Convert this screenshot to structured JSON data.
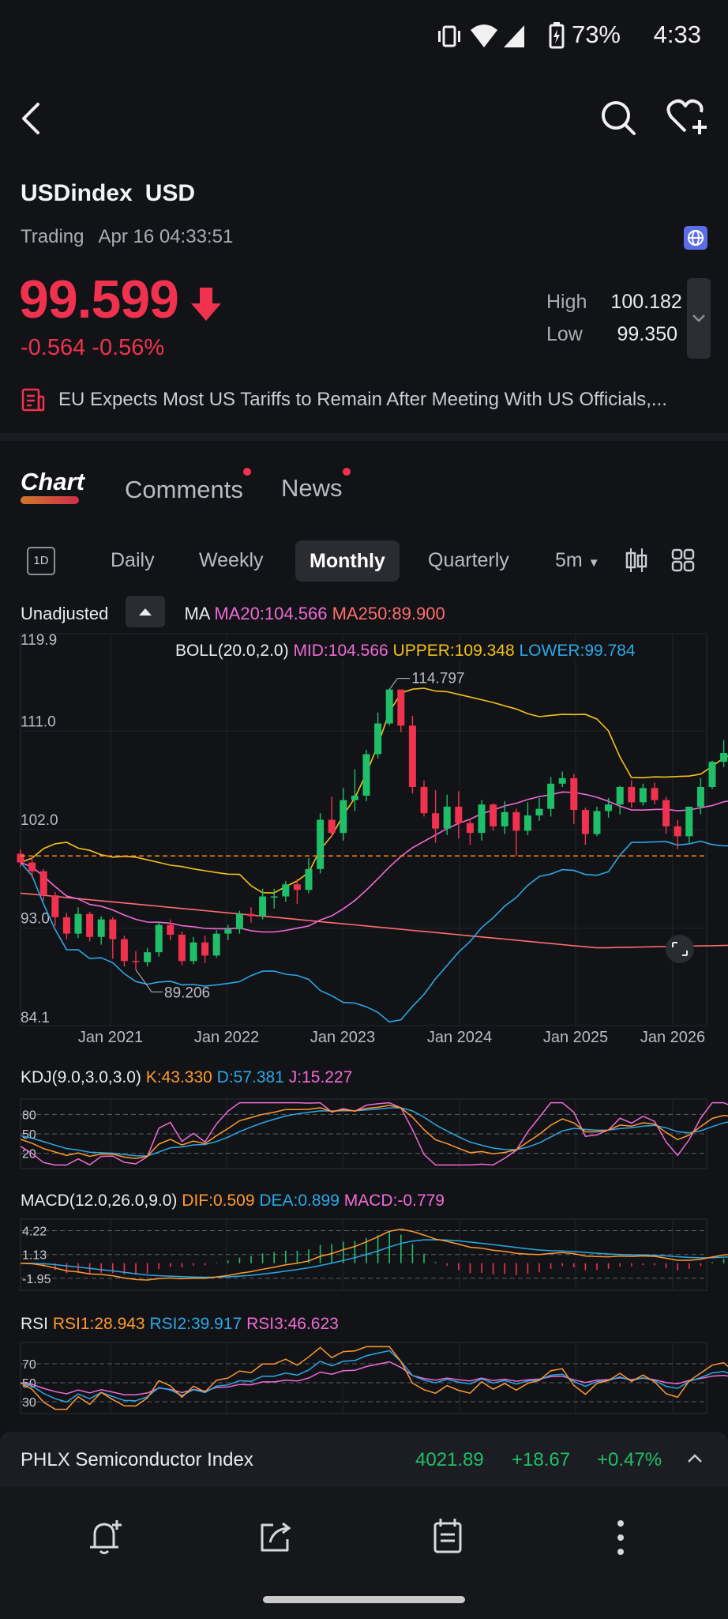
{
  "status": {
    "battery": "73%",
    "time": "4:33"
  },
  "header": {
    "symbol": "USDindex",
    "currency": "USD",
    "status": "Trading",
    "datetime": "Apr 16 04:33:51"
  },
  "quote": {
    "price": "99.599",
    "change": "-0.564",
    "change_pct": "-0.56%",
    "high_label": "High",
    "high": "100.182",
    "low_label": "Low",
    "low": "99.350"
  },
  "news_ticker": "EU Expects Most US Tariffs to Remain After Meeting With US Officials,...",
  "tabs": [
    {
      "label": "Chart"
    },
    {
      "label": "Comments"
    },
    {
      "label": "News"
    }
  ],
  "periods": [
    {
      "label": "1D"
    },
    {
      "label": "Daily"
    },
    {
      "label": "Weekly"
    },
    {
      "label": "Monthly"
    },
    {
      "label": "Quarterly"
    },
    {
      "label": "5m"
    }
  ],
  "chart_controls": {
    "adjust": "Unadjusted"
  },
  "ma": {
    "label": "MA",
    "ma20": "MA20:104.566",
    "ma250": "MA250:89.900"
  },
  "boll": {
    "label": "BOLL(20.0,2.0)",
    "mid": "MID:104.566",
    "upper": "UPPER:109.348",
    "lower": "LOWER:99.784"
  },
  "kdj": {
    "label": "KDJ(9.0,3.0,3.0)",
    "k": "K:43.330",
    "d": "D:57.381",
    "j": "J:15.227"
  },
  "macd": {
    "label": "MACD(12.0,26.0,9.0)",
    "dif": "DIF:0.509",
    "dea": "DEA:0.899",
    "macd": "MACD:-0.779"
  },
  "rsi": {
    "label": "RSI",
    "rsi1": "RSI1:28.943",
    "rsi2": "RSI2:39.917",
    "rsi3": "RSI3:46.623"
  },
  "bottom_ticker": {
    "name": "PHLX Semiconductor Index",
    "price": "4021.89",
    "change": "+18.67",
    "change_pct": "+0.47%"
  },
  "colors": {
    "up": "#1fbf6a",
    "down": "#f0324f",
    "ma20": "#f06bd6",
    "ma250": "#ff6e6e",
    "upper": "#f2c318",
    "lower": "#2aa8e6",
    "dif": "#ff9a2e"
  },
  "chart_data": [
    {
      "type": "candlestick",
      "title": "",
      "x_ticks": [
        "Jan 2021",
        "Jan 2022",
        "Jan 2023",
        "Jan 2024",
        "Jan 2025",
        "Jan 2026"
      ],
      "y_ticks": [
        119.9,
        111.0,
        102.0,
        93.0,
        84.1
      ],
      "ylim": [
        84.1,
        119.9
      ],
      "annotations": [
        "114.797",
        "89.206"
      ],
      "current_price": 99.599,
      "bars": [
        [
          99.8,
          99.0,
          100.2,
          98.6
        ],
        [
          99.0,
          98.2,
          99.5,
          97.6
        ],
        [
          98.2,
          96.0,
          98.4,
          95.5
        ],
        [
          96.0,
          94.0,
          96.3,
          93.2
        ],
        [
          94.0,
          92.5,
          94.4,
          92.0
        ],
        [
          92.5,
          94.3,
          94.9,
          92.1
        ],
        [
          94.3,
          92.2,
          94.5,
          91.8
        ],
        [
          92.2,
          93.8,
          94.1,
          91.5
        ],
        [
          93.8,
          92.0,
          94.0,
          90.2
        ],
        [
          92.0,
          90.0,
          92.3,
          89.5
        ],
        [
          90.0,
          89.9,
          90.9,
          89.2
        ],
        [
          89.9,
          90.8,
          91.2,
          89.5
        ],
        [
          90.8,
          93.3,
          93.6,
          90.4
        ],
        [
          93.3,
          92.4,
          93.8,
          91.9
        ],
        [
          92.4,
          90.0,
          92.7,
          89.6
        ],
        [
          90.0,
          91.7,
          92.2,
          89.7
        ],
        [
          91.7,
          90.5,
          92.3,
          89.8
        ],
        [
          90.5,
          92.5,
          92.8,
          90.3
        ],
        [
          92.5,
          92.9,
          93.3,
          91.9
        ],
        [
          92.9,
          94.3,
          94.6,
          92.5
        ],
        [
          94.3,
          94.1,
          94.9,
          93.5
        ],
        [
          94.1,
          95.9,
          96.6,
          93.8
        ],
        [
          95.9,
          95.9,
          96.6,
          94.8
        ],
        [
          95.9,
          97.0,
          97.3,
          95.4
        ],
        [
          97.0,
          96.5,
          97.5,
          95.2
        ],
        [
          96.5,
          98.4,
          99.4,
          96.2
        ],
        [
          98.4,
          102.9,
          103.5,
          98.0
        ],
        [
          102.9,
          101.7,
          105.0,
          101.3
        ],
        [
          101.7,
          104.7,
          105.8,
          101.0
        ],
        [
          104.7,
          105.1,
          107.5,
          103.7
        ],
        [
          105.1,
          108.9,
          109.3,
          104.6
        ],
        [
          108.9,
          111.7,
          112.7,
          108.5
        ],
        [
          111.7,
          114.8,
          114.8,
          111.5
        ],
        [
          114.8,
          111.5,
          114.4,
          110.9
        ],
        [
          111.5,
          105.9,
          112.4,
          105.3
        ],
        [
          105.9,
          103.5,
          106.5,
          103.2
        ],
        [
          103.5,
          102.1,
          105.6,
          100.8
        ],
        [
          102.1,
          104.1,
          105.2,
          101.5
        ],
        [
          104.1,
          102.6,
          105.5,
          101.2
        ],
        [
          102.6,
          101.7,
          103.0,
          100.6
        ],
        [
          101.7,
          104.3,
          104.7,
          101.0
        ],
        [
          104.3,
          102.3,
          104.4,
          101.9
        ],
        [
          102.3,
          103.6,
          104.6,
          101.6
        ],
        [
          103.6,
          101.9,
          103.9,
          99.6
        ],
        [
          101.9,
          103.3,
          104.5,
          101.5
        ],
        [
          103.3,
          103.9,
          104.9,
          102.8
        ],
        [
          103.9,
          106.2,
          106.8,
          103.2
        ],
        [
          106.2,
          106.7,
          107.3,
          105.9
        ],
        [
          106.7,
          103.8,
          107.1,
          102.5
        ],
        [
          103.8,
          101.6,
          104.0,
          100.6
        ],
        [
          101.6,
          103.7,
          104.1,
          101.4
        ],
        [
          103.7,
          104.3,
          104.9,
          103.1
        ],
        [
          104.3,
          105.9,
          106.0,
          103.4
        ],
        [
          105.9,
          104.5,
          106.5,
          104.0
        ],
        [
          104.5,
          105.8,
          106.2,
          104.2
        ],
        [
          105.8,
          104.7,
          106.3,
          104.3
        ],
        [
          104.7,
          102.3,
          105.0,
          101.6
        ],
        [
          102.3,
          101.4,
          102.9,
          100.2
        ],
        [
          101.4,
          104.1,
          104.1,
          100.8
        ],
        [
          104.1,
          105.9,
          106.7,
          103.4
        ],
        [
          105.9,
          108.2,
          108.3,
          105.7
        ],
        [
          108.2,
          109.0,
          110.2,
          107.7
        ],
        [
          109.0,
          107.6,
          109.8,
          106.3
        ],
        [
          107.6,
          104.3,
          107.7,
          103.7
        ],
        [
          104.3,
          99.6,
          104.4,
          99.3
        ]
      ],
      "ma20_last": 104.566,
      "ma250_last": 89.9,
      "boll_upper_last": 109.348,
      "boll_mid_last": 104.566,
      "boll_lower_last": 99.784
    },
    {
      "type": "line",
      "title": "",
      "y_ticks": [
        80,
        50,
        20
      ],
      "ylim": [
        0,
        100
      ]
    },
    {
      "type": "bar",
      "title": "",
      "y_ticks": [
        4.22,
        1.13,
        -1.95
      ]
    },
    {
      "type": "line",
      "title": "",
      "y_ticks": [
        70,
        50,
        30
      ],
      "ylim": [
        20,
        90
      ]
    }
  ]
}
